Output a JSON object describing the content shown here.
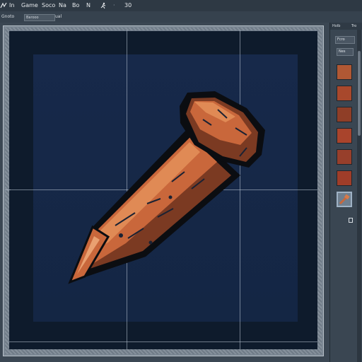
{
  "menubar": {
    "items": [
      "In",
      "Game",
      "Soco",
      "Na",
      "Bo",
      "N",
      "30"
    ]
  },
  "toolbar": {
    "label_1": "Gnoto",
    "field_1": "Barooo",
    "label_2": "ual"
  },
  "right_panel": {
    "tab_1": "Holb",
    "tab_2": "Tro",
    "field_1": "Fcro",
    "field_2": "Nes"
  },
  "colors": {
    "canvas_bg": "#0e1b2c",
    "art_bg": "#15294a",
    "nail_main": "#c9673b",
    "nail_dark": "#7b3a22",
    "nail_light": "#e08a55",
    "outline": "#0b0d11"
  },
  "swatches": [
    {
      "color": "#b05834"
    },
    {
      "color": "#c46b40"
    },
    {
      "color": "#a8482c"
    },
    {
      "color": "#c65f38"
    },
    {
      "color": "#8f3e27"
    },
    {
      "color": "#b9542f"
    },
    {
      "color": "#a9442c"
    },
    {
      "color": "#bd5937"
    },
    {
      "color": "#973f2b"
    },
    {
      "color": "#b44a2f"
    },
    {
      "color": "#9f3d29"
    },
    {
      "color": "#a84730"
    },
    {
      "color": "#a34a33",
      "selected": true,
      "icon": "nail-icon"
    },
    {
      "color": "#3a4652"
    }
  ],
  "icons": {
    "app": "app-logo-icon",
    "run": "running-figure-icon"
  }
}
